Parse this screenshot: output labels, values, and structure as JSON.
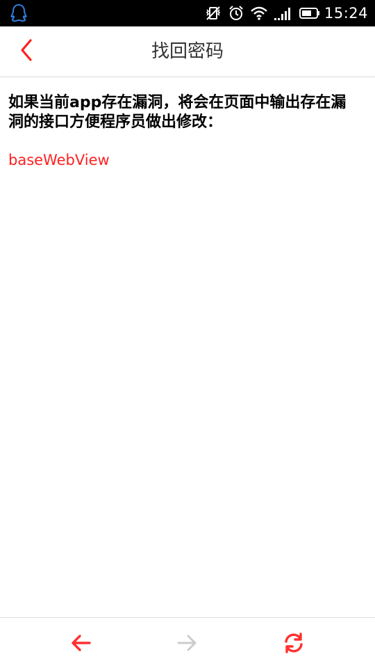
{
  "status_bar": {
    "time": "15:24",
    "icons": [
      "qq-icon",
      "vibrate-off-icon",
      "alarm-icon",
      "wifi-icon",
      "signal-icon",
      "battery-icon"
    ]
  },
  "header": {
    "title": "找回密码",
    "back_icon": "chevron-left-icon"
  },
  "main": {
    "notice": "如果当前app存在漏洞，将会在页面中输出存在漏洞的接口方便程序员做出修改：",
    "interfaces": [
      "baseWebView"
    ]
  },
  "toolbar": {
    "back_icon": "arrow-left-icon",
    "forward_icon": "arrow-right-icon",
    "refresh_icon": "refresh-icon"
  },
  "colors": {
    "accent": "#ff2020",
    "disabled": "#cccccc",
    "status_bar_bg": "#000000",
    "divider": "#dcdcdc"
  }
}
